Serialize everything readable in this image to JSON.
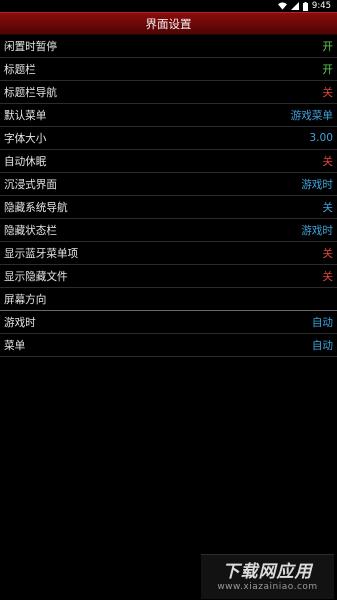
{
  "status_bar": {
    "time": "9:45",
    "icons": [
      "wifi-icon",
      "signal-icon",
      "battery-icon"
    ]
  },
  "title_bar": {
    "title": "界面设置"
  },
  "settings": [
    {
      "label": "闲置时暂停",
      "value": "开",
      "value_color": "#5fcf52"
    },
    {
      "label": "标题栏",
      "value": "开",
      "value_color": "#5fcf52"
    },
    {
      "label": "标题栏导航",
      "value": "关",
      "value_color": "#e0453d"
    },
    {
      "label": "默认菜单",
      "value": "游戏菜单",
      "value_color": "#3fa3dc"
    },
    {
      "label": "字体大小",
      "value": "3.00",
      "value_color": "#3fa3dc"
    },
    {
      "label": "自动休眠",
      "value": "关",
      "value_color": "#e0453d"
    },
    {
      "label": "沉浸式界面",
      "value": "游戏时",
      "value_color": "#3fa3dc"
    },
    {
      "label": "隐藏系统导航",
      "value": "关",
      "value_color": "#3fa3dc"
    },
    {
      "label": "隐藏状态栏",
      "value": "游戏时",
      "value_color": "#3fa3dc"
    },
    {
      "label": "显示蓝牙菜单项",
      "value": "关",
      "value_color": "#e0453d"
    },
    {
      "label": "显示隐藏文件",
      "value": "关",
      "value_color": "#e0453d"
    },
    {
      "label": "屏幕方向",
      "value": "",
      "value_color": "#3fa3dc"
    },
    {
      "label": "游戏时",
      "value": "自动",
      "value_color": "#3fa3dc"
    },
    {
      "label": "菜单",
      "value": "自动",
      "value_color": "#3fa3dc"
    }
  ],
  "watermark": {
    "title": "下载网应用",
    "subtitle": "www.xiazainiao.com"
  },
  "colors": {
    "title_bar": "#6a0808",
    "on": "#5fcf52",
    "off": "#e0453d",
    "value": "#3fa3dc"
  }
}
